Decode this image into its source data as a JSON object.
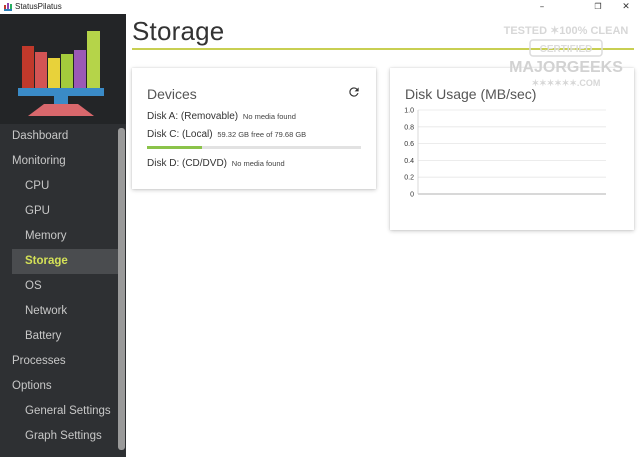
{
  "window": {
    "title": "StatusPilatus",
    "controls": {
      "minimize": "–",
      "maximize": "❐",
      "close": "✕"
    }
  },
  "sidebar": {
    "items": [
      {
        "label": "Dashboard",
        "level": 1,
        "active": false
      },
      {
        "label": "Monitoring",
        "level": 1,
        "active": false
      },
      {
        "label": "CPU",
        "level": 2,
        "active": false
      },
      {
        "label": "GPU",
        "level": 2,
        "active": false
      },
      {
        "label": "Memory",
        "level": 2,
        "active": false
      },
      {
        "label": "Storage",
        "level": 2,
        "active": true
      },
      {
        "label": "OS",
        "level": 2,
        "active": false
      },
      {
        "label": "Network",
        "level": 2,
        "active": false
      },
      {
        "label": "Battery",
        "level": 2,
        "active": false
      },
      {
        "label": "Processes",
        "level": 1,
        "active": false
      },
      {
        "label": "Options",
        "level": 1,
        "active": false
      },
      {
        "label": "General Settings",
        "level": 2,
        "active": false
      },
      {
        "label": "Graph Settings",
        "level": 2,
        "active": false
      }
    ]
  },
  "main": {
    "title": "Storage",
    "devices": {
      "title": "Devices",
      "refresh_icon": "refresh-icon",
      "disks": [
        {
          "name": "Disk A: (Removable)",
          "status": "No media found"
        },
        {
          "name": "Disk C: (Local)",
          "status": "59.32 GB free of 79.68 GB",
          "used_fraction": 0.256
        },
        {
          "name": "Disk D: (CD/DVD)",
          "status": "No media found"
        }
      ]
    },
    "disk_usage": {
      "title": "Disk Usage (MB/sec)"
    }
  },
  "watermark": {
    "line1": "TESTED ✶100% CLEAN",
    "line2": "CERTIFIED",
    "line3": "MAJORGEEKS",
    "line4": "✶✶✶✶✶✶.COM"
  },
  "colors": {
    "sidebar_bg": "#2e3033",
    "accent": "#d4e157",
    "title_rule": "#c8cf52",
    "progress": "#8bc34a"
  },
  "chart_data": {
    "type": "line",
    "title": "Disk Usage (MB/sec)",
    "xlabel": "",
    "ylabel": "",
    "ylim": [
      0,
      1.0
    ],
    "y_ticks": [
      "1.0",
      "0.8",
      "0.6",
      "0.4",
      "0.2",
      "0"
    ],
    "grid": true,
    "series": []
  }
}
